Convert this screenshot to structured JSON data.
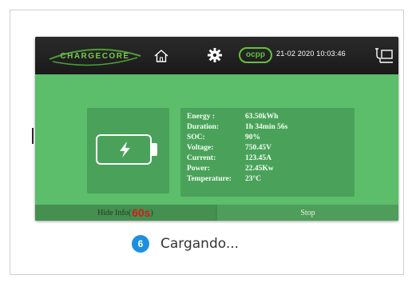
{
  "device": {
    "brand": "CHARGECORE",
    "ocpp_label": "ocpp",
    "datetime": "21-02 2020  10:03:46",
    "icons": {
      "home": "home-icon",
      "settings": "gear-icon",
      "plug": "plug-icon",
      "battery": "battery-charging-icon"
    }
  },
  "charging_info": [
    {
      "label": "Energy :",
      "value": "63.50kWh"
    },
    {
      "label": "Duration:",
      "value": "1h 34min 56s"
    },
    {
      "label": "SOC:",
      "value": "90%"
    },
    {
      "label": "Voltage:",
      "value": "750.45V"
    },
    {
      "label": "Current:",
      "value": "123.45A"
    },
    {
      "label": "Power:",
      "value": "22.45Kw"
    },
    {
      "label": "Temperature:",
      "value": "23°C"
    }
  ],
  "buttons": {
    "hide_info_label": "Hide Info(",
    "hide_info_countdown": "60s",
    "hide_info_close": ")",
    "stop_label": "Stop"
  },
  "caption": {
    "step_number": "6",
    "text": "Cargando..."
  },
  "colors": {
    "screen_green": "#5cbd6a",
    "panel_green": "#4aa25a",
    "accent_green": "#63c13b",
    "countdown_red": "#d41b1b",
    "step_blue": "#1e8fe0"
  }
}
